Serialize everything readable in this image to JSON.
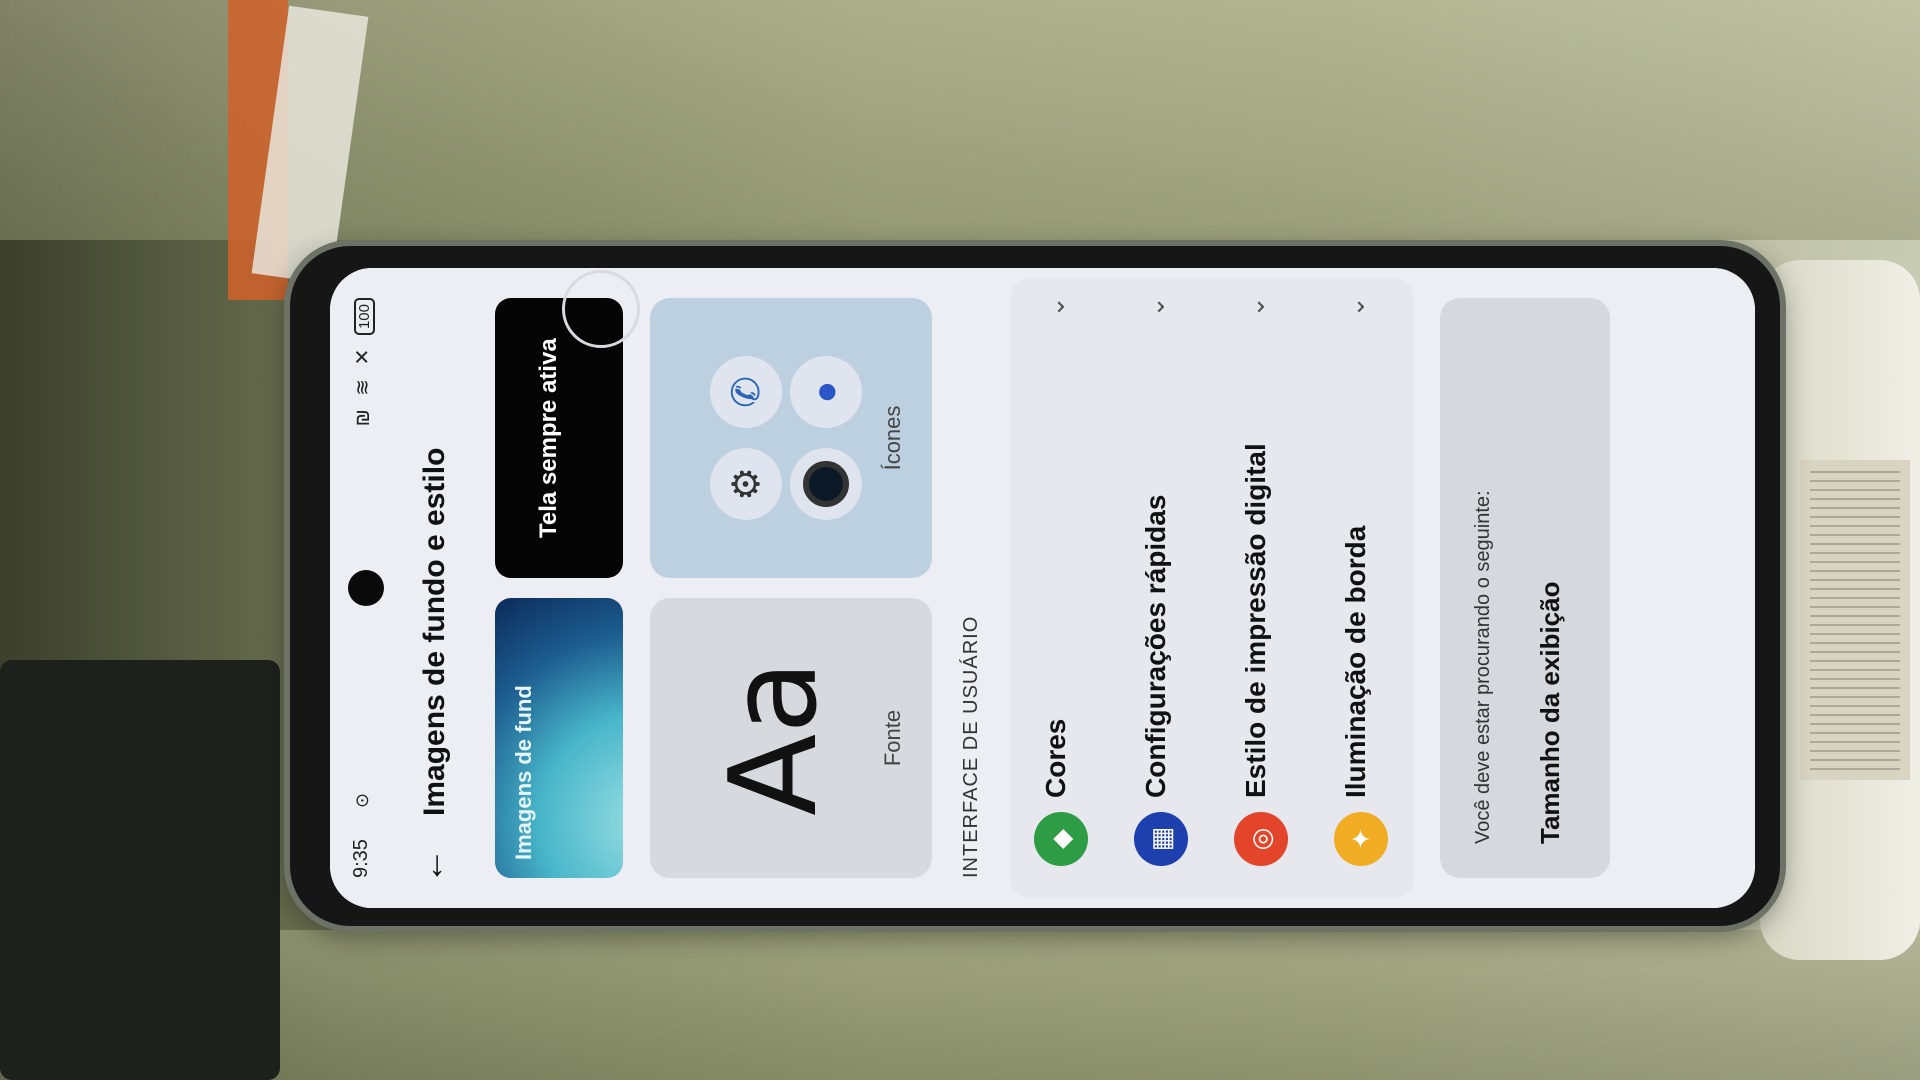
{
  "status": {
    "time": "9:35",
    "battery": "100"
  },
  "header": {
    "title": "Imagens de fundo e estilo"
  },
  "previews": {
    "wallpaper_label": "Imagens de fund",
    "aod_label": "Tela sempre ativa"
  },
  "cards": {
    "font_sample": "Aa",
    "font_label": "Fonte",
    "icons_label": "Ícones"
  },
  "section_title": "INTERFACE DE USUÁRIO",
  "items": [
    {
      "label": "Cores",
      "color": "#2e9b45"
    },
    {
      "label": "Configurações rápidas",
      "color": "#1e3fae"
    },
    {
      "label": "Estilo de impressão digital",
      "color": "#e2452a"
    },
    {
      "label": "Iluminação de borda",
      "color": "#f0ad23"
    }
  ],
  "suggestion": {
    "prompt": "Você deve estar procurando o seguinte:",
    "link": "Tamanho da exibição"
  }
}
